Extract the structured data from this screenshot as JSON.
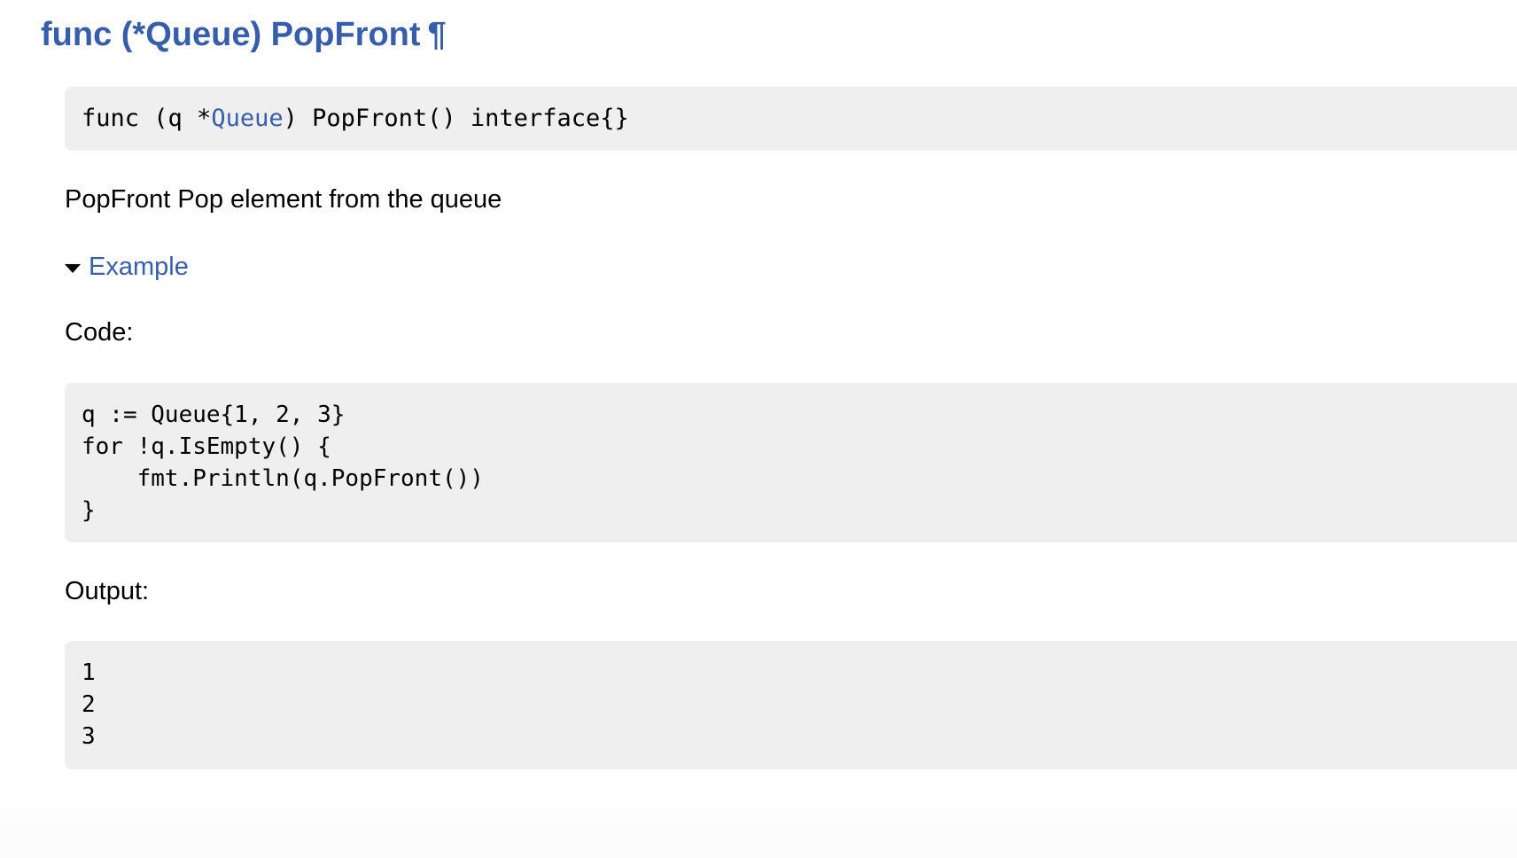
{
  "heading": {
    "text": "func (*Queue) PopFront",
    "anchor": "¶"
  },
  "signature": {
    "prefix": "func (q *",
    "type_link": "Queue",
    "suffix": ") PopFront() interface{}"
  },
  "doc": {
    "text": "PopFront Pop element from the queue"
  },
  "example": {
    "toggle_label": "Example",
    "code_label": "Code:",
    "code_lines": [
      "q := Queue{1, 2, 3}",
      "for !q.IsEmpty() {",
      "    fmt.Println(q.PopFront())",
      "}"
    ],
    "output_label": "Output:",
    "output_lines": [
      "1",
      "2",
      "3"
    ]
  },
  "colors": {
    "link": "#375eab",
    "code_background": "#efefef",
    "text": "#000000"
  },
  "icons": {
    "toggle": "triangle-down-icon",
    "anchor": "pilcrow-icon"
  }
}
